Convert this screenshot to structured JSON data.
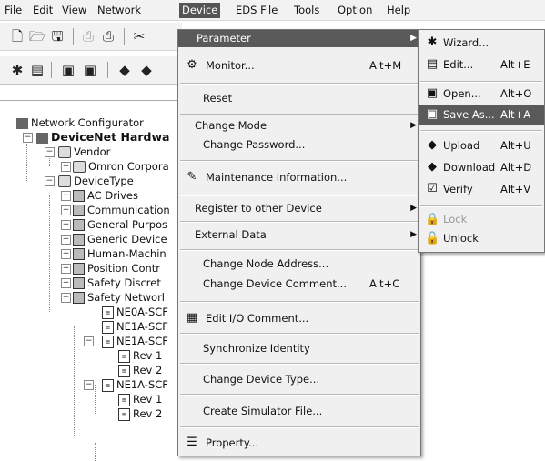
{
  "menubar": {
    "items": [
      {
        "label": "File"
      },
      {
        "label": "Edit"
      },
      {
        "label": "View"
      },
      {
        "label": "Network"
      },
      {
        "label": "Device"
      },
      {
        "label": "EDS File"
      },
      {
        "label": "Tools"
      },
      {
        "label": "Option"
      },
      {
        "label": "Help"
      }
    ]
  },
  "tree": {
    "root": "Network Configurator",
    "hardware": "DeviceNet Hardwa",
    "vendor": "Vendor",
    "omron": "Omron Corpora",
    "devicetype": "DeviceType",
    "groups": [
      "AC Drives",
      "Communication",
      "General Purpos",
      "Generic Device",
      "Human-Machin",
      "Position Contr",
      "Safety Discret",
      "Safety Networl"
    ],
    "devices": {
      "d1": "NE0A-SCF",
      "d2": "NE1A-SCF",
      "d3": "NE1A-SCF",
      "rev1": "Rev 1",
      "rev2": "Rev 2",
      "d4": "NE1A-SCF",
      "rev1b": "Rev 1",
      "rev2b": "Rev 2"
    }
  },
  "device_menu": {
    "parameter": "Parameter",
    "monitor": "Monitor...",
    "monitor_sc": "Alt+M",
    "reset": "Reset",
    "change_mode": "Change Mode",
    "change_password": "Change Password...",
    "maintenance": "Maintenance Information...",
    "register": "Register to other Device",
    "external": "External Data",
    "change_node": "Change Node Address...",
    "change_comment": "Change Device Comment...",
    "change_comment_sc": "Alt+C",
    "edit_io": "Edit I/O Comment...",
    "sync": "Synchronize Identity",
    "change_type": "Change Device Type...",
    "simulator": "Create Simulator File...",
    "property": "Property..."
  },
  "param_menu": {
    "wizard": "Wizard...",
    "edit": "Edit...",
    "edit_sc": "Alt+E",
    "open": "Open...",
    "open_sc": "Alt+O",
    "saveas": "Save As...",
    "saveas_sc": "Alt+A",
    "upload": "Upload",
    "upload_sc": "Alt+U",
    "download": "Download",
    "download_sc": "Alt+D",
    "verify": "Verify",
    "verify_sc": "Alt+V",
    "lock": "Lock",
    "unlock": "Unlock"
  }
}
